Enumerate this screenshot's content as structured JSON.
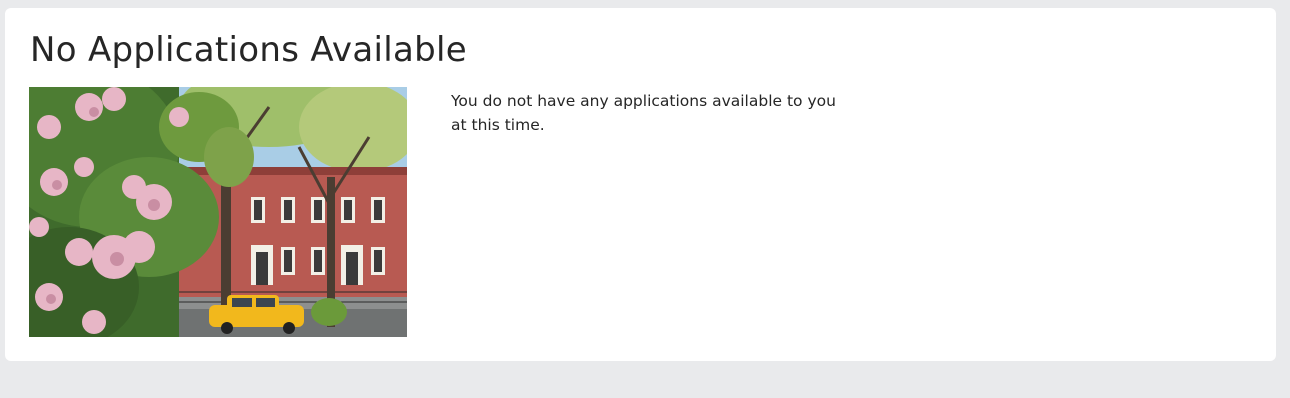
{
  "card": {
    "title": "No Applications Available",
    "message": "You do not have any applications available to you at this time."
  },
  "colors": {
    "page_background": "#e9eaec",
    "card_background": "#ffffff",
    "text": "#262626"
  }
}
